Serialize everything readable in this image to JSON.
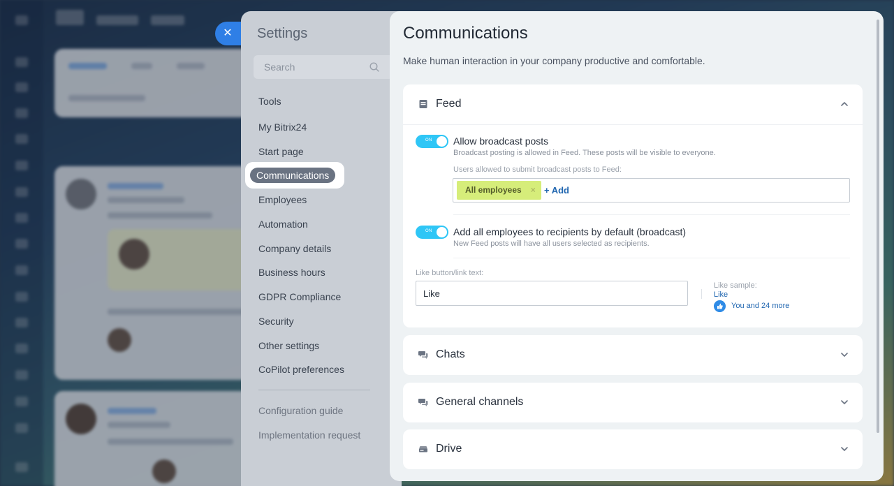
{
  "settings": {
    "title": "Settings",
    "search_placeholder": "Search",
    "nav": [
      {
        "label": "Tools"
      },
      {
        "label": "My Bitrix24"
      },
      {
        "label": "Start page"
      },
      {
        "label": "Communications",
        "active": true
      },
      {
        "label": "Employees"
      },
      {
        "label": "Automation"
      },
      {
        "label": "Company details"
      },
      {
        "label": "Business hours"
      },
      {
        "label": "GDPR Compliance"
      },
      {
        "label": "Security"
      },
      {
        "label": "Other settings"
      },
      {
        "label": "CoPilot preferences"
      }
    ],
    "nav_secondary": [
      {
        "label": "Configuration guide"
      },
      {
        "label": "Implementation request"
      }
    ]
  },
  "main": {
    "title": "Communications",
    "subtitle": "Make human interaction in your company productive and comfortable.",
    "feed": {
      "title": "Feed",
      "icon": "document-icon",
      "expanded": true,
      "broadcast": {
        "toggle_label": "ON",
        "enabled": true,
        "title": "Allow broadcast posts",
        "description": "Broadcast posting is allowed in Feed. These posts will be visible to everyone.",
        "users_label": "Users allowed to submit broadcast posts to Feed:",
        "tag": "All employees",
        "tag_remove": "×",
        "add_label": "+ Add"
      },
      "recipients": {
        "toggle_label": "ON",
        "enabled": true,
        "title": "Add all employees to recipients by default (broadcast)",
        "description": "New Feed posts will have all users selected as recipients."
      },
      "like": {
        "label": "Like button/link text:",
        "value": "Like",
        "sample_label": "Like sample:",
        "sample_link": "Like",
        "sample_more": "You and 24 more"
      }
    },
    "chats": {
      "title": "Chats",
      "icon": "chat-bubbles-icon",
      "expanded": false
    },
    "channels": {
      "title": "General channels",
      "icon": "chat-bubbles-icon",
      "expanded": false
    },
    "drive": {
      "title": "Drive",
      "icon": "drive-icon",
      "expanded": false
    }
  },
  "colors": {
    "accent": "#2fc6f6",
    "link": "#2066b0",
    "tag_bg": "#d6ed7a",
    "close_button": "#2f7fe6"
  }
}
